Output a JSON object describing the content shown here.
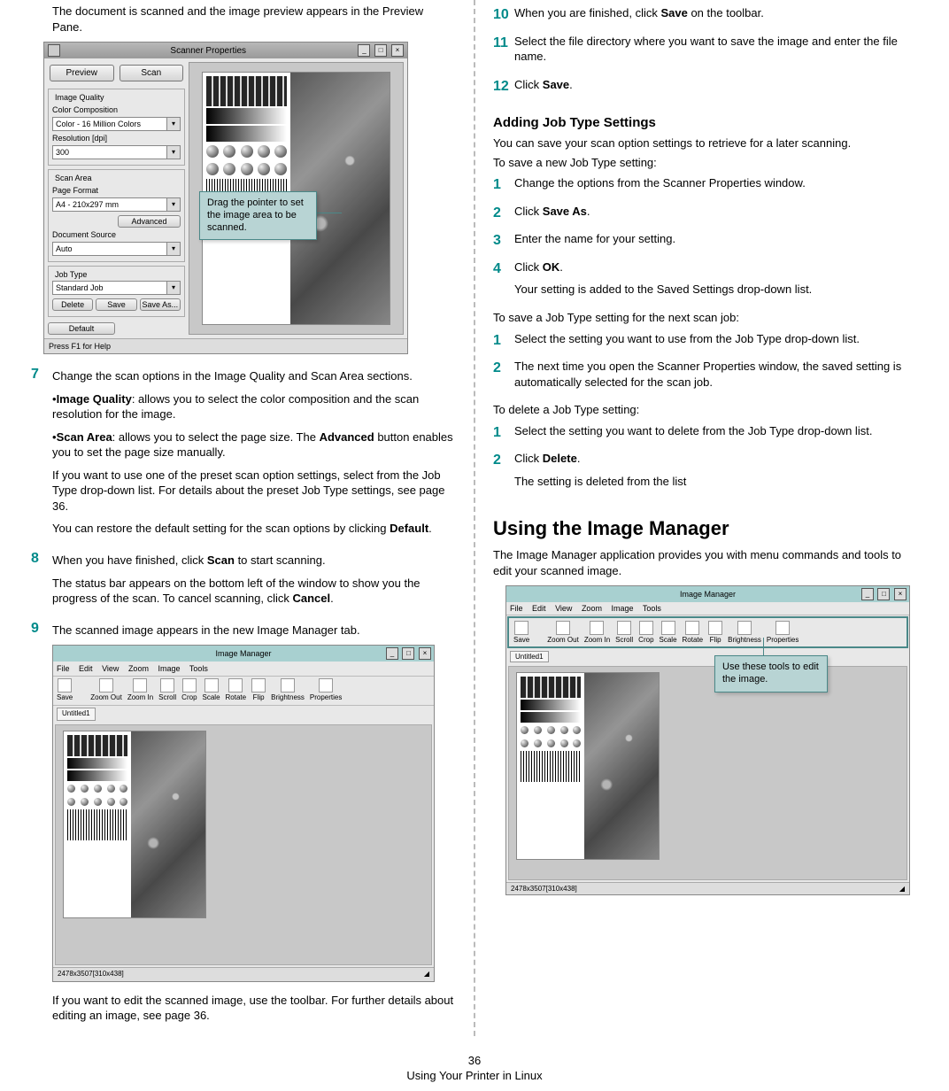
{
  "left": {
    "intro_scan": "The document is scanned and the image preview appears in the Preview Pane.",
    "callout_scanner": "Drag the pointer to set the image area to be scanned.",
    "scanner_win": {
      "title": "Scanner Properties",
      "btn_preview": "Preview",
      "btn_scan": "Scan",
      "grp_iq": "Image Quality",
      "lbl_colorcomp": "Color Composition",
      "val_colorcomp": "Color - 16 Million Colors",
      "lbl_res": "Resolution [dpi]",
      "val_res": "300",
      "grp_sa": "Scan Area",
      "lbl_pageformat": "Page Format",
      "val_pageformat": "A4 - 210x297 mm",
      "btn_advanced": "Advanced",
      "lbl_docsrc": "Document Source",
      "val_docsrc": "Auto",
      "grp_jt": "Job Type",
      "val_jt": "Standard Job",
      "btn_delete": "Delete",
      "btn_save": "Save",
      "btn_saveas": "Save As...",
      "btn_default": "Default",
      "status": "Press F1 for Help"
    },
    "step7": {
      "n": "7",
      "text": "Change the scan options in the Image Quality and Scan Area sections.",
      "b1_label": "Image Quality",
      "b1_rest": ": allows you to select the color composition and the scan resolution for the image.",
      "b2_label": "Scan Area",
      "b2_mid": ": allows you to select the page size. The ",
      "b2_adv": "Advanced",
      "b2_end": " button enables you to set the page size manually.",
      "p3": "If you want to use one of the preset scan option settings, select from the Job Type drop-down list. For details about the preset Job Type settings, see page 36.",
      "p4a": "You can restore the default setting for the scan options by clicking ",
      "p4b": "Default",
      "p4c": "."
    },
    "step8": {
      "n": "8",
      "t1a": "When you have finished, click ",
      "t1b": "Scan",
      "t1c": " to start scanning.",
      "t2a": "The status bar appears on the bottom left of the window to show you the progress of the scan. To cancel scanning, click ",
      "t2b": "Cancel",
      "t2c": "."
    },
    "step9": {
      "n": "9",
      "t1": "The scanned image appears in the new Image Manager tab.",
      "t2": "If you want to edit the scanned image, use the toolbar. For further details about editing an image, see page 36."
    },
    "im_win": {
      "title": "Image Manager",
      "menu": {
        "file": "File",
        "edit": "Edit",
        "view": "View",
        "zoom": "Zoom",
        "image": "Image",
        "tools": "Tools"
      },
      "tools": {
        "save": "Save",
        "zoomout": "Zoom Out",
        "zoomin": "Zoom In",
        "scroll": "Scroll",
        "crop": "Crop",
        "scale": "Scale",
        "rotate": "Rotate",
        "flip": "Flip",
        "brightness": "Brightness",
        "properties": "Properties"
      },
      "tab": "Untitled1",
      "status": "2478x3507[310x438]"
    }
  },
  "right": {
    "step10": {
      "n": "10",
      "a": "When you are finished, click ",
      "b": "Save",
      "c": " on the toolbar."
    },
    "step11": {
      "n": "11",
      "t": "Select the file directory where you want to save the image and enter the file name."
    },
    "step12": {
      "n": "12",
      "a": "Click ",
      "b": "Save",
      "c": "."
    },
    "h_add": "Adding Job Type Settings",
    "add_intro": "You can save your scan option settings to retrieve for a later scanning.",
    "save_new_intro": "To save a new Job Type setting:",
    "sn1": {
      "n": "1",
      "t": "Change the options from the Scanner Properties window."
    },
    "sn2": {
      "n": "2",
      "a": "Click ",
      "b": "Save As",
      "c": "."
    },
    "sn3": {
      "n": "3",
      "t": "Enter the name for your setting."
    },
    "sn4": {
      "n": "4",
      "a": "Click ",
      "b": "OK",
      "c": ".",
      "p": "Your setting is added to the Saved Settings drop-down list."
    },
    "save_next_intro": "To save a Job Type setting for the next scan job:",
    "ns1": {
      "n": "1",
      "t": "Select the setting you want to use from the Job Type drop-down list."
    },
    "ns2": {
      "n": "2",
      "t": "The next time you open the Scanner Properties window, the saved setting is automatically selected for the scan job."
    },
    "del_intro": "To delete a Job Type setting:",
    "d1": {
      "n": "1",
      "t": "Select the setting you want to delete from the Job Type drop-down list."
    },
    "d2": {
      "n": "2",
      "a": "Click ",
      "b": "Delete",
      "c": ".",
      "p": "The setting is deleted from the list"
    },
    "h_im": "Using the Image Manager",
    "im_intro": "The Image Manager application provides you with menu commands and tools to edit your scanned image.",
    "callout_im": "Use these tools to edit the image."
  },
  "footer": {
    "page": "36",
    "section": "Using Your Printer in Linux"
  }
}
